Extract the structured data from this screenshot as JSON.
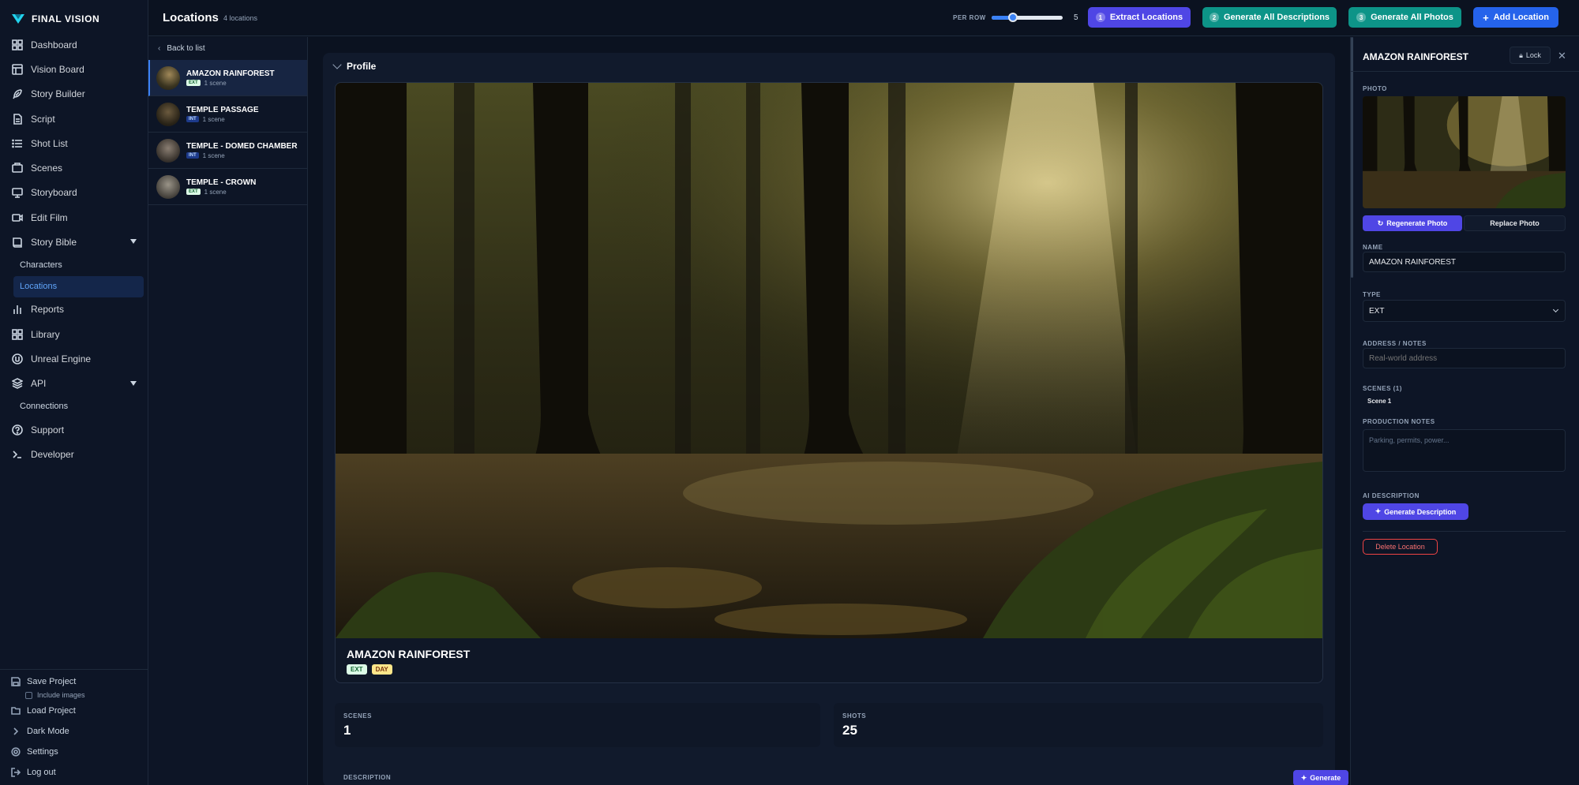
{
  "brand": {
    "name": "FINAL VISION"
  },
  "sidebar": {
    "items": [
      {
        "label": "Dashboard",
        "icon": "dashboard-icon"
      },
      {
        "label": "Vision Board",
        "icon": "board-icon"
      },
      {
        "label": "Story Builder",
        "icon": "feather-icon"
      },
      {
        "label": "Script",
        "icon": "document-icon"
      },
      {
        "label": "Shot List",
        "icon": "list-icon"
      },
      {
        "label": "Scenes",
        "icon": "film-icon"
      },
      {
        "label": "Storyboard",
        "icon": "monitor-icon"
      },
      {
        "label": "Edit Film",
        "icon": "video-icon"
      },
      {
        "label": "Story Bible",
        "icon": "book-icon",
        "expanded": true
      },
      {
        "label": "Characters",
        "sub": true
      },
      {
        "label": "Locations",
        "sub": true,
        "active": true
      },
      {
        "label": "Reports",
        "icon": "bar-chart-icon"
      },
      {
        "label": "Library",
        "icon": "grid-icon"
      },
      {
        "label": "Unreal Engine",
        "icon": "unreal-icon"
      },
      {
        "label": "API",
        "icon": "layers-icon",
        "expanded": true
      },
      {
        "label": "Connections",
        "sub": true
      },
      {
        "label": "Support",
        "icon": "help-icon"
      },
      {
        "label": "Developer",
        "icon": "terminal-icon"
      }
    ],
    "bottom": {
      "save_project": "Save Project",
      "include_images": "Include images",
      "load_project": "Load Project",
      "dark_mode": "Dark Mode",
      "settings": "Settings",
      "log_out": "Log out"
    }
  },
  "topbar": {
    "title": "Locations",
    "count": "4 locations",
    "per_row_label": "PER ROW",
    "per_row_value": "5",
    "per_row_fraction": 0.3,
    "extract": {
      "num": "1",
      "label": "Extract Locations"
    },
    "descriptions": {
      "num": "2",
      "label": "Generate All Descriptions"
    },
    "photos": {
      "num": "3",
      "label": "Generate All Photos"
    },
    "add": {
      "label": "Add Location"
    }
  },
  "list": {
    "back": "Back to list",
    "locations": [
      {
        "name": "AMAZON RAINFOREST",
        "type": "EXT",
        "scenes": "1 scene",
        "active": true
      },
      {
        "name": "TEMPLE PASSAGE",
        "type": "INT",
        "scenes": "1 scene"
      },
      {
        "name": "TEMPLE - DOMED CHAMBER",
        "type": "INT",
        "scenes": "1 scene"
      },
      {
        "name": "TEMPLE - CROWN",
        "type": "EXT",
        "scenes": "1 scene"
      }
    ]
  },
  "main": {
    "section": "Profile",
    "name": "AMAZON RAINFOREST",
    "type_badge": "EXT",
    "time_badge": "DAY",
    "stats": {
      "scenes_label": "SCENES",
      "scenes_value": "1",
      "shots_label": "SHOTS",
      "shots_value": "25"
    },
    "description_label": "DESCRIPTION",
    "generate": "Generate"
  },
  "detail": {
    "title": "AMAZON RAINFOREST",
    "lock": "Lock",
    "photo_label": "PHOTO",
    "regenerate": "Regenerate Photo",
    "replace": "Replace Photo",
    "name_label": "NAME",
    "name_value": "AMAZON RAINFOREST",
    "type_label": "TYPE",
    "type_value": "EXT",
    "address_label": "ADDRESS / NOTES",
    "address_placeholder": "Real-world address",
    "scenes_label": "SCENES (1)",
    "scene_chip": "Scene 1",
    "notes_label": "PRODUCTION NOTES",
    "notes_placeholder": "Parking, permits, power...",
    "ai_label": "AI DESCRIPTION",
    "generate_description": "Generate Description",
    "delete": "Delete Location"
  },
  "colors": {
    "bg": "#0b1220",
    "panel": "#0d1526",
    "accent": "#4f46e5",
    "teal": "#0d9488",
    "blue": "#2563eb",
    "danger": "#ef4444"
  }
}
